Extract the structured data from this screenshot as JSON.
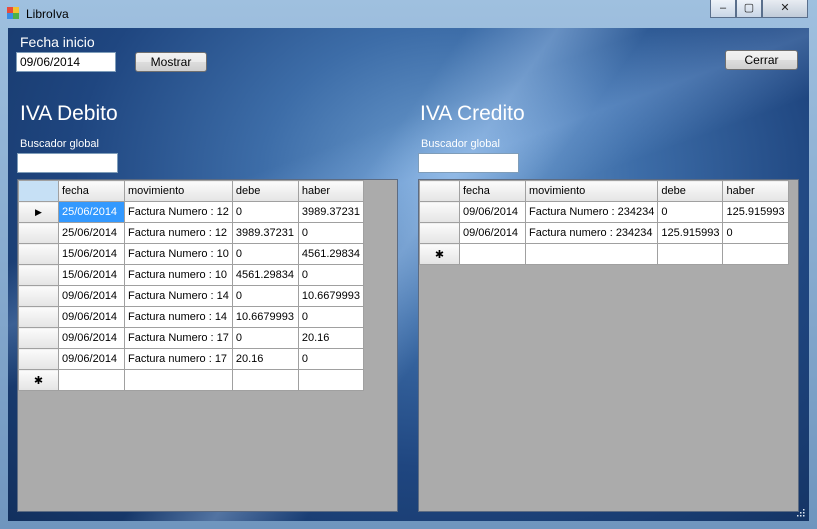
{
  "window": {
    "title": "LibroIva",
    "controls": {
      "minimize": "–",
      "maximize": "▢",
      "close": "✕"
    }
  },
  "filter": {
    "fecha_label": "Fecha inicio",
    "fecha_value": "09/06/2014",
    "mostrar_label": "Mostrar",
    "cerrar_label": "Cerrar"
  },
  "debito": {
    "title": "IVA Debito",
    "search_label": "Buscador global",
    "columns": [
      "fecha",
      "movimiento",
      "debe",
      "haber"
    ],
    "rows": [
      [
        "25/06/2014",
        "Factura Numero : 12",
        "0",
        "3989.37231"
      ],
      [
        "25/06/2014",
        "Factura numero : 12",
        "3989.37231",
        "0"
      ],
      [
        "15/06/2014",
        "Factura Numero : 10",
        "0",
        "4561.29834"
      ],
      [
        "15/06/2014",
        "Factura numero : 10",
        "4561.29834",
        "0"
      ],
      [
        "09/06/2014",
        "Factura Numero : 14",
        "0",
        "10.6679993"
      ],
      [
        "09/06/2014",
        "Factura numero : 14",
        "10.6679993",
        "0"
      ],
      [
        "09/06/2014",
        "Factura Numero : 17",
        "0",
        "20.16"
      ],
      [
        "09/06/2014",
        "Factura numero : 17",
        "20.16",
        "0"
      ]
    ],
    "current_row_glyph": "▶",
    "new_row_glyph": "✱"
  },
  "credito": {
    "title": "IVA Credito",
    "search_label": "Buscador global",
    "columns": [
      "fecha",
      "movimiento",
      "debe",
      "haber"
    ],
    "rows": [
      [
        "09/06/2014",
        "Factura Numero : 234234",
        "0",
        "125.915993"
      ],
      [
        "09/06/2014",
        "Factura numero : 234234",
        "125.915993",
        "0"
      ]
    ],
    "new_row_glyph": "✱"
  },
  "colors": {
    "selection": "#3399ff",
    "grid_background": "#ababab",
    "label_text": "#ffffff"
  }
}
